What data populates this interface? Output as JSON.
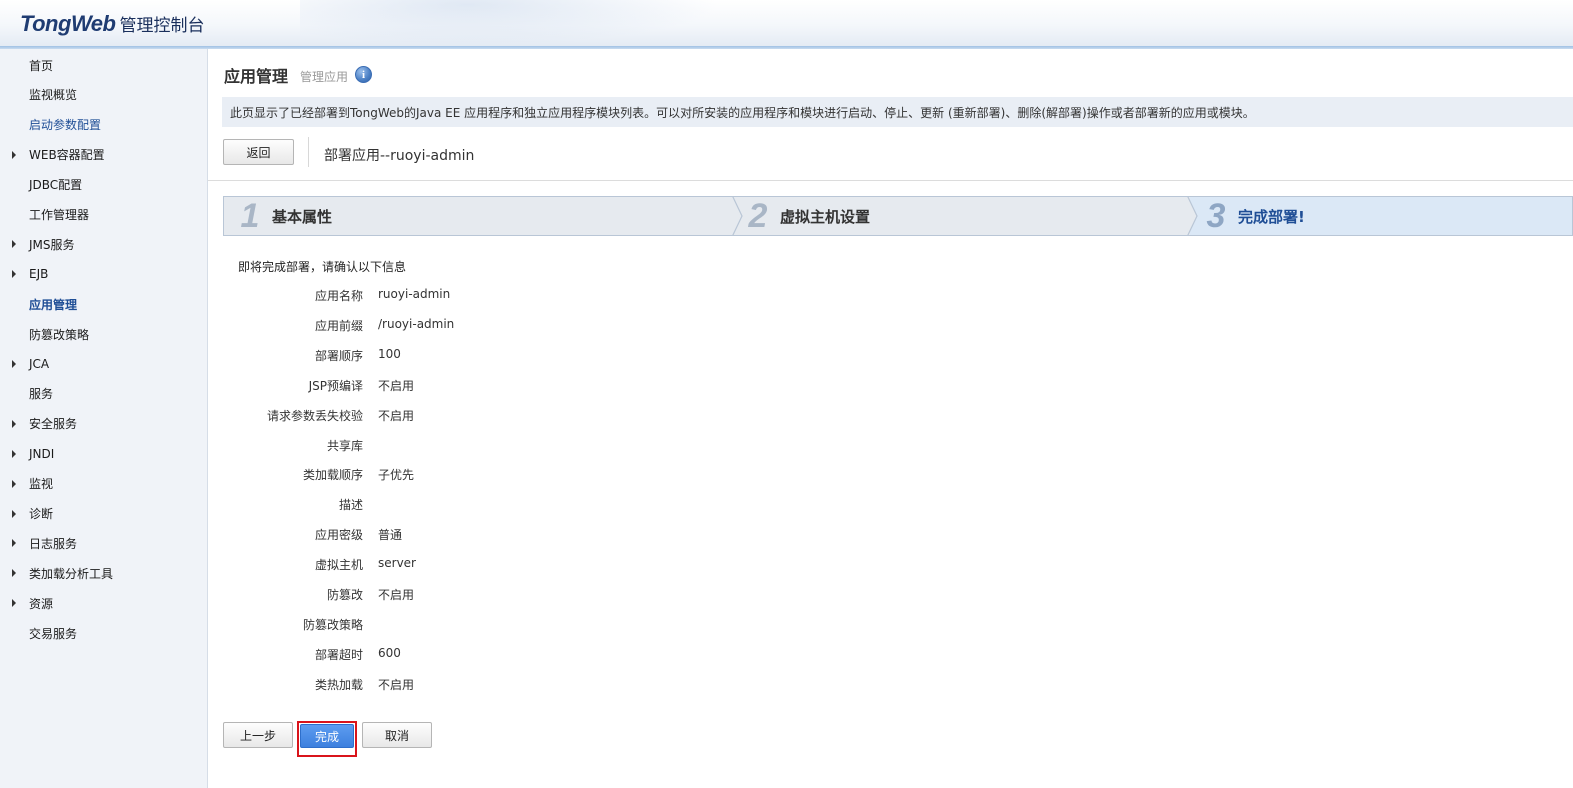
{
  "header": {
    "brand": "TongWeb",
    "subtitle": "管理控制台"
  },
  "sidebar": {
    "items": [
      {
        "label": "首页",
        "expandable": false,
        "style": "normal"
      },
      {
        "label": "监视概览",
        "expandable": false,
        "style": "normal"
      },
      {
        "label": "启动参数配置",
        "expandable": false,
        "style": "link"
      },
      {
        "label": "WEB容器配置",
        "expandable": true,
        "style": "normal"
      },
      {
        "label": "JDBC配置",
        "expandable": false,
        "style": "normal"
      },
      {
        "label": "工作管理器",
        "expandable": false,
        "style": "normal"
      },
      {
        "label": "JMS服务",
        "expandable": true,
        "style": "normal"
      },
      {
        "label": "EJB",
        "expandable": true,
        "style": "normal"
      },
      {
        "label": "应用管理",
        "expandable": false,
        "style": "active"
      },
      {
        "label": "防篡改策略",
        "expandable": false,
        "style": "normal"
      },
      {
        "label": "JCA",
        "expandable": true,
        "style": "normal"
      },
      {
        "label": "服务",
        "expandable": false,
        "style": "normal"
      },
      {
        "label": "安全服务",
        "expandable": true,
        "style": "normal"
      },
      {
        "label": "JNDI",
        "expandable": true,
        "style": "normal"
      },
      {
        "label": "监视",
        "expandable": true,
        "style": "normal"
      },
      {
        "label": "诊断",
        "expandable": true,
        "style": "normal"
      },
      {
        "label": "日志服务",
        "expandable": true,
        "style": "normal"
      },
      {
        "label": "类加载分析工具",
        "expandable": true,
        "style": "normal"
      },
      {
        "label": "资源",
        "expandable": true,
        "style": "normal"
      },
      {
        "label": "交易服务",
        "expandable": false,
        "style": "normal"
      }
    ]
  },
  "main": {
    "title": "应用管理",
    "subtitle": "管理应用",
    "info_icon": "info-icon",
    "description": "此页显示了已经部署到TongWeb的Java EE 应用程序和独立应用程序模块列表。可以对所安装的应用程序和模块进行启动、停止、更新 (重新部署)、删除(解部署)操作或者部署新的应用或模块。",
    "back_label": "返回",
    "deploy_title": "部署应用--ruoyi-admin",
    "steps": [
      {
        "num": "1",
        "label": "基本属性"
      },
      {
        "num": "2",
        "label": "虚拟主机设置"
      },
      {
        "num": "3",
        "label": "完成部署!"
      }
    ],
    "current_step": 3,
    "confirm_text": "即将完成部署，请确认以下信息",
    "properties": [
      {
        "key": "应用名称",
        "value": "ruoyi-admin"
      },
      {
        "key": "应用前缀",
        "value": "/ruoyi-admin"
      },
      {
        "key": "部署顺序",
        "value": "100"
      },
      {
        "key": "JSP预编译",
        "value": "不启用"
      },
      {
        "key": "请求参数丢失校验",
        "value": "不启用"
      },
      {
        "key": "共享库",
        "value": ""
      },
      {
        "key": "类加载顺序",
        "value": "子优先"
      },
      {
        "key": "描述",
        "value": ""
      },
      {
        "key": "应用密级",
        "value": "普通"
      },
      {
        "key": "虚拟主机",
        "value": "server"
      },
      {
        "key": "防篡改",
        "value": "不启用"
      },
      {
        "key": "防篡改策略",
        "value": ""
      },
      {
        "key": "部署超时",
        "value": "600"
      },
      {
        "key": "类热加载",
        "value": "不启用"
      }
    ],
    "buttons": {
      "prev": "上一步",
      "finish": "完成",
      "cancel": "取消"
    }
  },
  "colors": {
    "link": "#1f4e96",
    "primary_button": "#3d80de",
    "highlight_outline": "#d9141b",
    "sidebar_bg": "#f0f3f8",
    "description_bg": "#e9eef5"
  }
}
